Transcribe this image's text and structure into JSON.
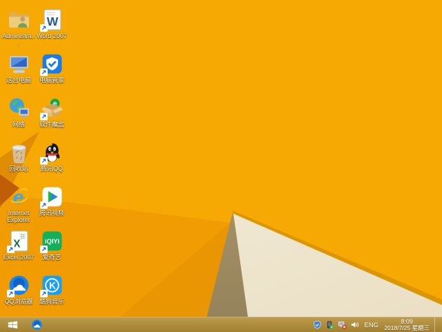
{
  "wallpaper": {
    "base_color": "#f6a902",
    "cream_color": "#f2ecda",
    "khaki_color": "#ac9567",
    "edge_strip_color": "#dc9503",
    "dark_wedge_color": "#e08d05",
    "red_triangle_color": "#c05e08"
  },
  "desktop": {
    "icons": [
      {
        "label": "Administra...",
        "name": "user-folder"
      },
      {
        "label": "Word 2007",
        "name": "word-2007"
      },
      {
        "label": "这台电脑",
        "name": "this-pc"
      },
      {
        "label": "电脑管家",
        "name": "pc-manager"
      },
      {
        "label": "网络",
        "name": "network"
      },
      {
        "label": "软件魔盒",
        "name": "software-box"
      },
      {
        "label": "回收站",
        "name": "recycle-bin"
      },
      {
        "label": "腾讯QQ",
        "name": "tencent-qq"
      },
      {
        "label": "Internet Explorer",
        "name": "internet-explorer"
      },
      {
        "label": "腾讯视频",
        "name": "tencent-video"
      },
      {
        "label": "Excel 2007",
        "name": "excel-2007"
      },
      {
        "label": "爱奇艺",
        "name": "iqiyi"
      },
      {
        "label": "QQ浏览器",
        "name": "qq-browser"
      },
      {
        "label": "酷狗音乐",
        "name": "kugou-music"
      }
    ]
  },
  "taskbar": {
    "taskbar_color": "#b08e3e",
    "tray": {
      "language": "ENG",
      "time": "8:09",
      "date": "2018/7/25 星期三"
    }
  }
}
